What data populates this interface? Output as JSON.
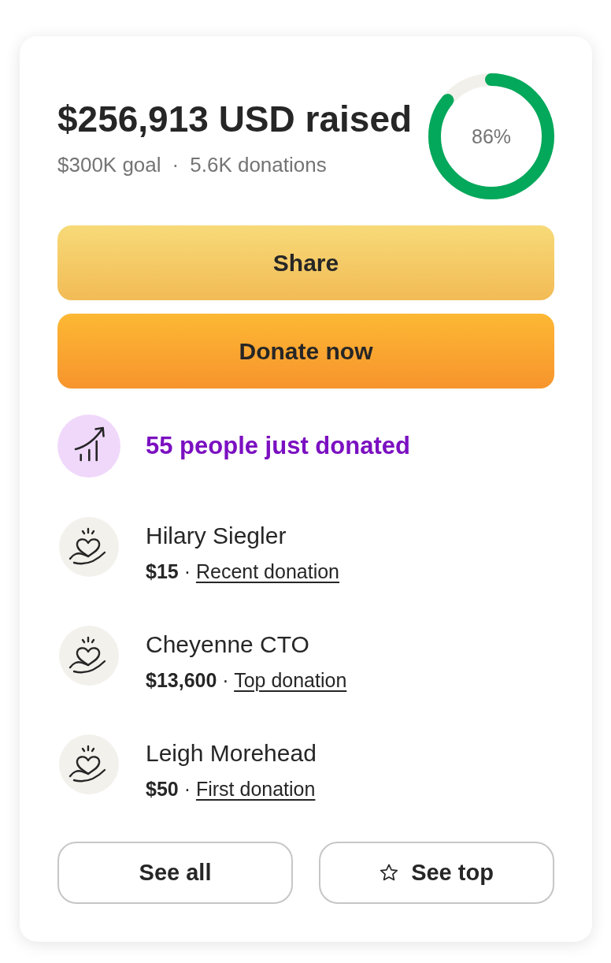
{
  "campaign": {
    "raised": "$256,913 USD raised",
    "goal": "$300K goal",
    "separator": "·",
    "donations": "5.6K donations",
    "progress": {
      "level": 0.86,
      "label": "86%"
    }
  },
  "actions": [
    {
      "kind": "share",
      "label": "Share"
    },
    {
      "kind": "donate",
      "label": "Donate now"
    }
  ],
  "activity": {
    "text": "55 people just donated"
  },
  "donors": [
    {
      "name": "Hilary Siegler",
      "amount": "$15",
      "separator": "·",
      "tag": "Recent donation"
    },
    {
      "name": "Cheyenne CTO",
      "amount": "$13,600",
      "separator": "·",
      "tag": "Top donation"
    },
    {
      "name": "Leigh Morehead",
      "amount": "$50",
      "separator": "·",
      "tag": "First donation"
    }
  ],
  "footer_buttons": [
    {
      "kind": "plain",
      "label": "See all"
    },
    {
      "kind": "starred",
      "label": "See top"
    }
  ]
}
